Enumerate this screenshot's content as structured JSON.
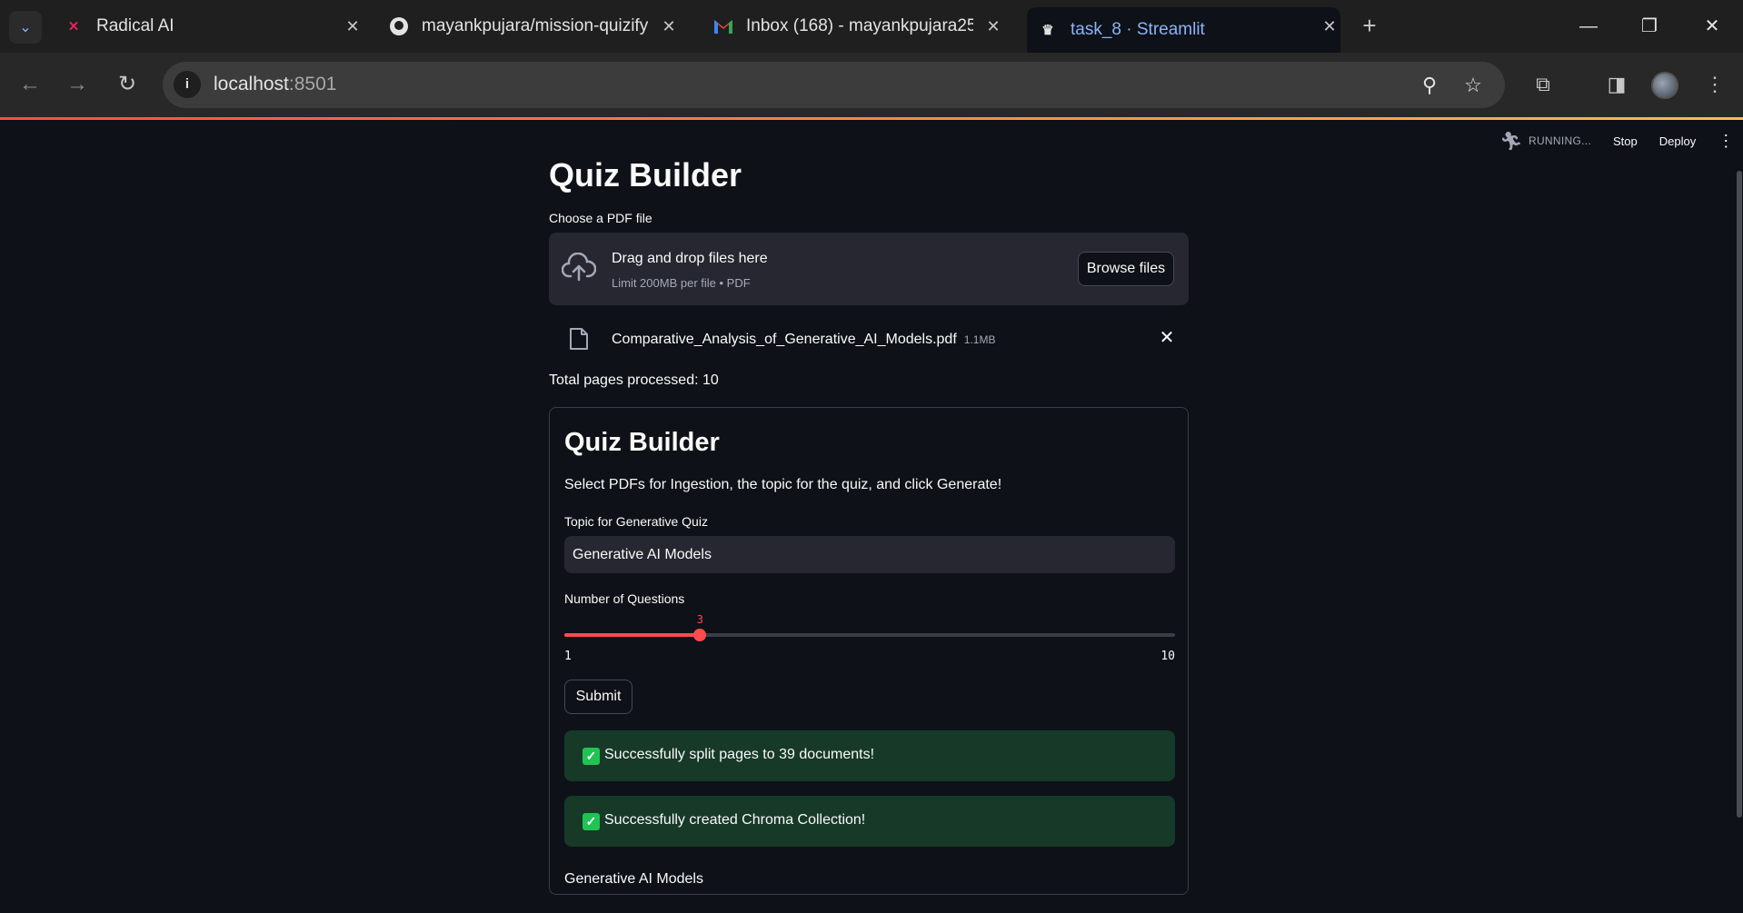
{
  "browser": {
    "tabs": [
      {
        "title": "Radical AI",
        "favicon": "radical-ai-logo",
        "active": false
      },
      {
        "title": "mayankpujara/mission-quizify: I",
        "favicon": "github-icon",
        "active": false
      },
      {
        "title": "Inbox (168) - mayankpujara25@",
        "favicon": "gmail-icon",
        "active": false
      },
      {
        "title": "task_8 · Streamlit",
        "favicon": "streamlit-icon",
        "active": true
      }
    ],
    "url_host": "localhost",
    "url_port": ":8501",
    "accent": "#8ab4f8"
  },
  "streamlit_header": {
    "status": "RUNNING...",
    "stop_label": "Stop",
    "deploy_label": "Deploy"
  },
  "page": {
    "title": "Quiz Builder",
    "uploader": {
      "label": "Choose a PDF file",
      "drop_text": "Drag and drop files here",
      "limit_text": "Limit 200MB per file • PDF",
      "browse_label": "Browse files"
    },
    "file": {
      "name": "Comparative_Analysis_of_Generative_AI_Models.pdf",
      "size": "1.1MB"
    },
    "pages_processed": "Total pages processed: 10",
    "form": {
      "title": "Quiz Builder",
      "description": "Select PDFs for Ingestion, the topic for the quiz, and click Generate!",
      "topic_label": "Topic for Generative Quiz",
      "topic_value": "Generative AI Models",
      "questions_label": "Number of Questions",
      "slider": {
        "min": 1,
        "max": 10,
        "value": 3,
        "min_label": "1",
        "max_label": "10",
        "value_label": "3"
      },
      "submit_label": "Submit",
      "alerts": [
        "Successfully split pages to 39 documents!",
        "Successfully created Chroma Collection!"
      ],
      "result_text": "Generative AI Models"
    }
  },
  "colors": {
    "primary": "#ff4b4b",
    "success_bg": "#173928",
    "success_icon": "#21c354",
    "background": "#0e1117"
  }
}
